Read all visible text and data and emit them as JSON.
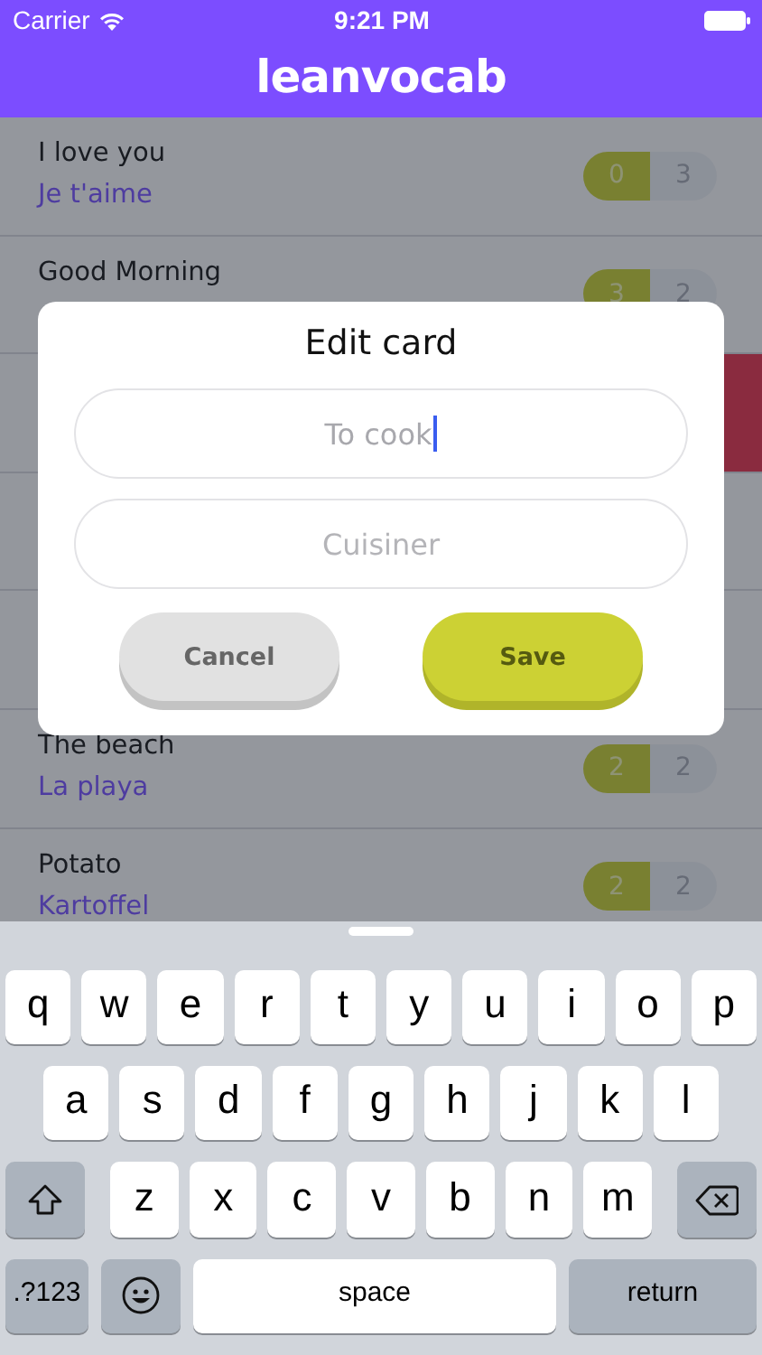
{
  "status_bar": {
    "carrier": "Carrier",
    "time": "9:21 PM"
  },
  "header": {
    "title": "leanvocab"
  },
  "cards": [
    {
      "term": "I love you",
      "translation": "Je t'aime",
      "correct": "0",
      "wrong": "3"
    },
    {
      "term": "Good Morning",
      "correct": "3",
      "wrong": "2"
    },
    {
      "swiped": true
    },
    {
      "swiped": false
    },
    {
      "swiped": false
    },
    {
      "term": "The beach",
      "translation": "La playa",
      "correct": "2",
      "wrong": "2"
    },
    {
      "term": "Potato",
      "translation": "Kartoffel",
      "correct": "2",
      "wrong": "2"
    }
  ],
  "dialog": {
    "title": "Edit card",
    "fields": [
      {
        "value": "To cook",
        "focused": true
      },
      {
        "placeholder": "Cuisiner",
        "focused": false
      }
    ],
    "buttons": [
      {
        "label": "Cancel",
        "kind": "cancel"
      },
      {
        "label": "Save",
        "kind": "save"
      }
    ]
  },
  "keyboard": {
    "rows": [
      {
        "keys": [
          {
            "kind": "letter",
            "label": "q"
          },
          {
            "kind": "letter",
            "label": "w"
          },
          {
            "kind": "letter",
            "label": "e"
          },
          {
            "kind": "letter",
            "label": "r"
          },
          {
            "kind": "letter",
            "label": "t"
          },
          {
            "kind": "letter",
            "label": "y"
          },
          {
            "kind": "letter",
            "label": "u"
          },
          {
            "kind": "letter",
            "label": "i"
          },
          {
            "kind": "letter",
            "label": "o"
          },
          {
            "kind": "letter",
            "label": "p"
          }
        ]
      },
      {
        "keys": [
          {
            "kind": "letter",
            "label": "a"
          },
          {
            "kind": "letter",
            "label": "s"
          },
          {
            "kind": "letter",
            "label": "d"
          },
          {
            "kind": "letter",
            "label": "f"
          },
          {
            "kind": "letter",
            "label": "g"
          },
          {
            "kind": "letter",
            "label": "h"
          },
          {
            "kind": "letter",
            "label": "j"
          },
          {
            "kind": "letter",
            "label": "k"
          },
          {
            "kind": "letter",
            "label": "l"
          }
        ]
      },
      {
        "keys": [
          {
            "kind": "shift"
          },
          {
            "kind": "letter",
            "label": "z"
          },
          {
            "kind": "letter",
            "label": "x"
          },
          {
            "kind": "letter",
            "label": "c"
          },
          {
            "kind": "letter",
            "label": "v"
          },
          {
            "kind": "letter",
            "label": "b"
          },
          {
            "kind": "letter",
            "label": "n"
          },
          {
            "kind": "letter",
            "label": "m"
          },
          {
            "kind": "backspace"
          }
        ]
      },
      {
        "keys": [
          {
            "kind": "mode",
            "label": ".?123"
          },
          {
            "kind": "emoji"
          },
          {
            "kind": "space",
            "label": "space"
          },
          {
            "kind": "return",
            "label": "return"
          }
        ]
      }
    ]
  }
}
